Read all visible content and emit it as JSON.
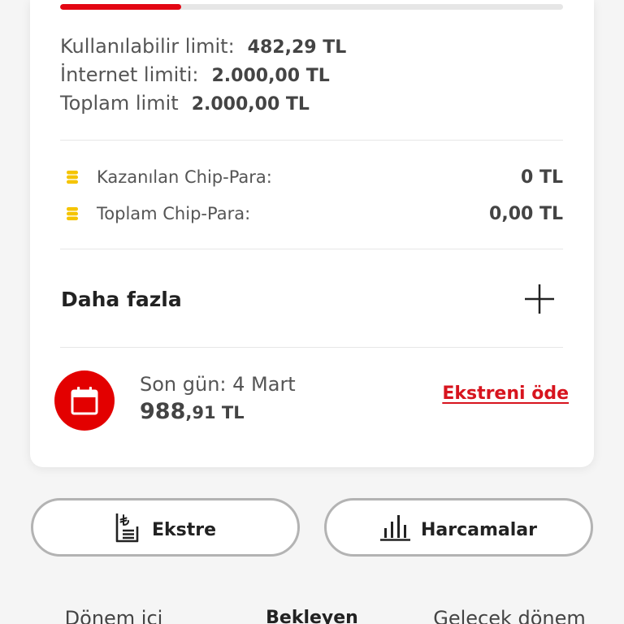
{
  "colors": {
    "accent": "#e30613",
    "link": "#d7141e",
    "coin": "#f5c400",
    "background": "#f5f5f5",
    "card": "#ffffff"
  },
  "limits": {
    "bar_fill_fraction": 0.24,
    "rows": [
      {
        "label": "Kullanılabilir limit:",
        "value": "482,29 TL"
      },
      {
        "label": "İnternet limiti:",
        "value": "2.000,00 TL"
      },
      {
        "label": "Toplam limit",
        "value": "2.000,00 TL"
      }
    ]
  },
  "chip_para": [
    {
      "icon": "coin-stack-icon",
      "label": "Kazanılan Chip-Para:",
      "value": "0 TL"
    },
    {
      "icon": "coin-stack-icon",
      "label": "Toplam Chip-Para:",
      "value": "0,00 TL"
    }
  ],
  "more": {
    "label": "Daha fazla",
    "icon": "plus-icon"
  },
  "statement": {
    "icon": "calendar-icon",
    "due_label": "Son gün: 4 Mart",
    "amount_main": "988",
    "amount_rest": ",91 TL",
    "pay_link": "Ekstreni öde"
  },
  "actions": [
    {
      "label": "Ekstre",
      "icon": "statement-document-icon"
    },
    {
      "label": "Harcamalar",
      "icon": "bar-chart-icon"
    }
  ],
  "tabs": [
    {
      "label": "Dönem içi",
      "active": false
    },
    {
      "label": "Bekleyen",
      "active": true
    },
    {
      "label": "Gelecek dönem",
      "active": false
    }
  ]
}
